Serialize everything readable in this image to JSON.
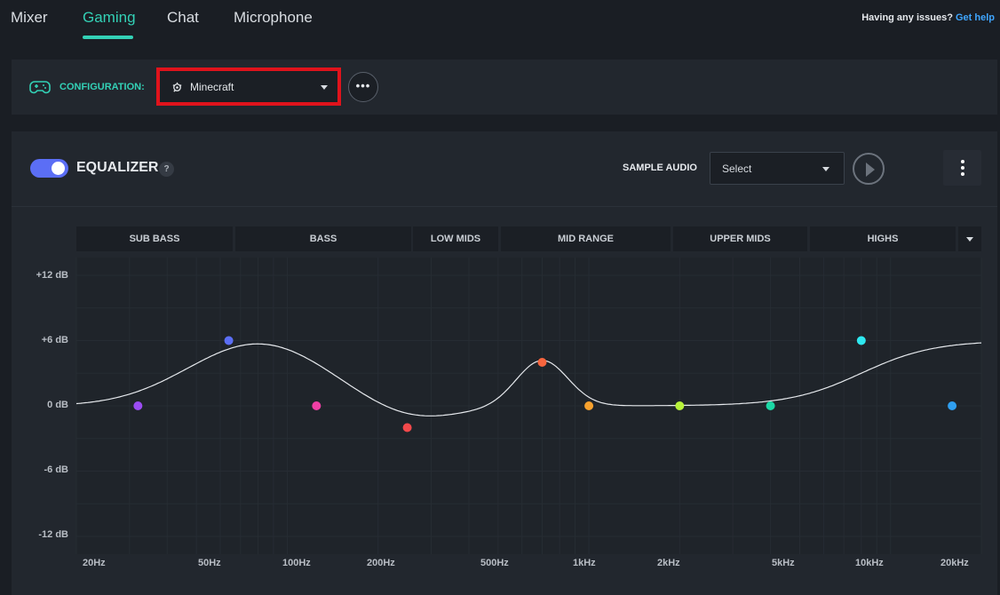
{
  "nav": {
    "tabs": [
      {
        "label": "Mixer",
        "active": false
      },
      {
        "label": "Gaming",
        "active": true
      },
      {
        "label": "Chat",
        "active": false
      },
      {
        "label": "Microphone",
        "active": false
      }
    ],
    "help_text": "Having any issues?",
    "help_link": "Get help"
  },
  "config": {
    "label": "CONFIGURATION:",
    "selected": "Minecraft",
    "more_label": "•••",
    "icon": "gamepad-icon"
  },
  "equalizer": {
    "enabled": true,
    "title": "EQUALIZER",
    "help": "?",
    "sample_label": "SAMPLE AUDIO",
    "sample_select": "Select",
    "bands": [
      "SUB BASS",
      "BASS",
      "LOW MIDS",
      "MID RANGE",
      "UPPER MIDS",
      "HIGHS"
    ],
    "y_labels": [
      "+12 dB",
      "+6 dB",
      "0 dB",
      "-6 dB",
      "-12 dB"
    ],
    "x_labels": [
      "20Hz",
      "50Hz",
      "100Hz",
      "200Hz",
      "500Hz",
      "1kHz",
      "2kHz",
      "5kHz",
      "10kHz",
      "20kHz"
    ]
  },
  "chart_data": {
    "type": "line",
    "xlabel": "",
    "ylabel": "",
    "ylim": [
      -12,
      12
    ],
    "x_scale": "log",
    "points": [
      {
        "freq": 32,
        "gain": 0,
        "color": "#9b4cf2"
      },
      {
        "freq": 64,
        "gain": 6,
        "color": "#5b6ef5"
      },
      {
        "freq": 125,
        "gain": 0,
        "color": "#ef3fa5"
      },
      {
        "freq": 250,
        "gain": -2,
        "color": "#f2494b"
      },
      {
        "freq": 700,
        "gain": 4,
        "color": "#f7653e"
      },
      {
        "freq": 1000,
        "gain": 0,
        "color": "#f7a12e"
      },
      {
        "freq": 2000,
        "gain": 0,
        "color": "#b7f23a"
      },
      {
        "freq": 4000,
        "gain": 0,
        "color": "#1bd7a5"
      },
      {
        "freq": 8000,
        "gain": 6,
        "color": "#2ee8f0"
      },
      {
        "freq": 16000,
        "gain": 0,
        "color": "#2f9ff0"
      }
    ]
  },
  "colors": {
    "accent": "#33d1b6",
    "toggle": "#5b6ef5",
    "highlight_border": "#e0131c",
    "link": "#3fa6ff"
  }
}
